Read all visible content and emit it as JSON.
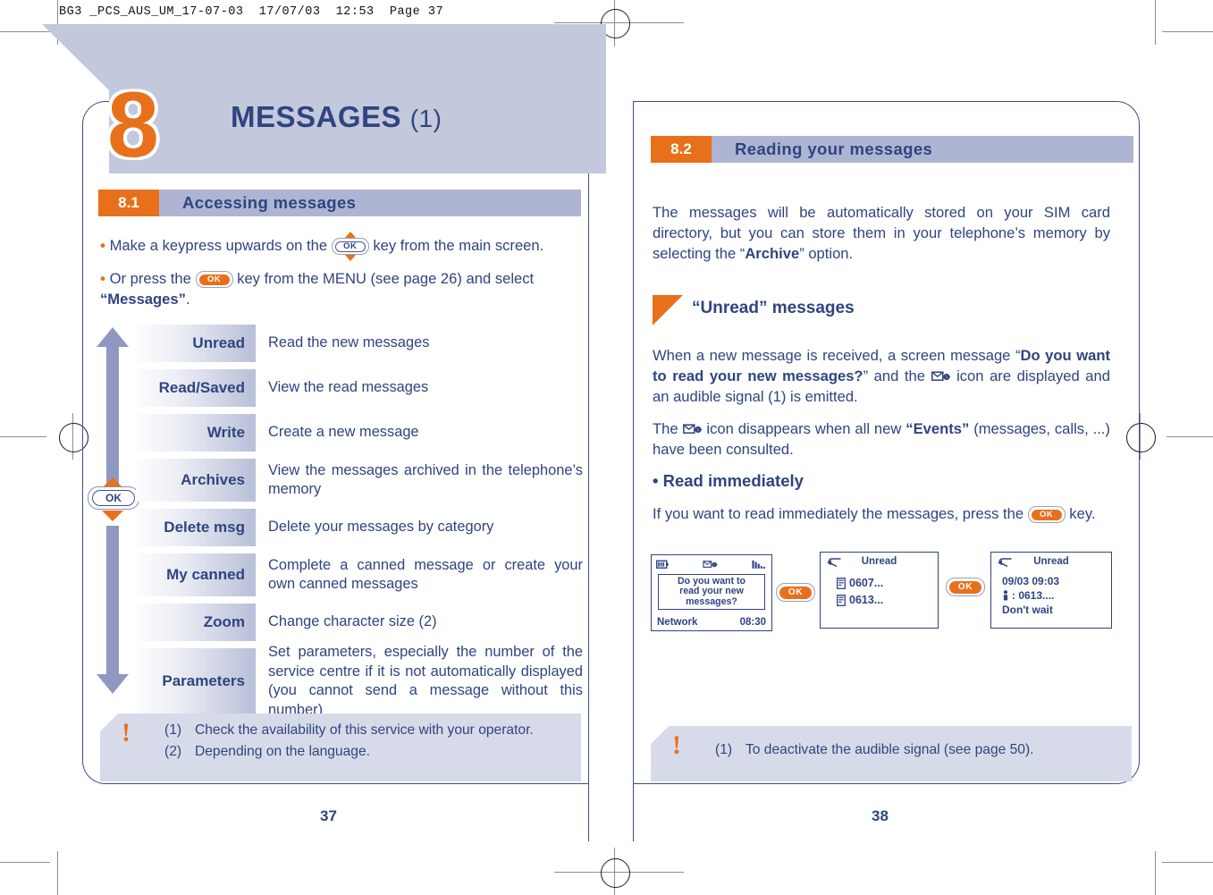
{
  "print_header": "BG3 _PCS_AUS_UM_17-07-03  17/07/03  12:53  Page 37",
  "chapter": {
    "number": "8",
    "title": "MESSAGES",
    "roman": "(1)"
  },
  "left_page": {
    "page_number": "37",
    "section": {
      "number": "8.1",
      "name": "Accessing messages"
    },
    "bullets": [
      {
        "before": "Make a keypress upwards on the",
        "key": "OK",
        "after": "key from the main screen."
      },
      {
        "before": "Or press the",
        "key": "OK",
        "after": "key from the MENU (see page 26) and select",
        "bold_tail": "“Messages”",
        "tail_end": "."
      }
    ],
    "menu_items": [
      {
        "label": "Unread",
        "desc": "Read the new messages"
      },
      {
        "label": "Read/Saved",
        "desc": "View the read messages"
      },
      {
        "label": "Write",
        "desc": "Create a new message"
      },
      {
        "label": "Archives",
        "desc": "View the messages archived in the telephone’s memory"
      },
      {
        "label": "Delete msg",
        "desc": "Delete your messages by category"
      },
      {
        "label": "My canned",
        "desc": "Complete a canned message or create your own canned messages"
      },
      {
        "label": "Zoom",
        "desc": "Change character size (2)"
      },
      {
        "label": "Parameters",
        "desc": "Set parameters, especially the number of the service centre if it is not automatically displayed (you cannot send a message without this number)"
      }
    ],
    "nav_key_label": "OK",
    "footnotes": [
      {
        "num": "(1)",
        "text": "Check the availability of this service with your operator."
      },
      {
        "num": "(2)",
        "text": "Depending on the language."
      }
    ]
  },
  "right_page": {
    "page_number": "38",
    "section": {
      "number": "8.2",
      "name": "Reading your messages"
    },
    "intro": {
      "part1": "The messages will be automatically stored on your SIM card directory, but you can store them in your telephone’s memory by selecting the “",
      "bold": "Archive",
      "part2": "” option."
    },
    "subsection_title": "“Unread” messages",
    "para1": {
      "part1": "When a new message is received, a screen message “",
      "bold1": "Do you want to read your new messages?",
      "part2": "” and the",
      "icon": "envelope-event-icon",
      "part3": "icon are displayed and an audible signal (1) is emitted."
    },
    "para2": {
      "part1": "The",
      "icon": "envelope-event-icon",
      "part2": "icon disappears when all new",
      "bold1": "“Events”",
      "part3": "(messages, calls, ...) have been consulted."
    },
    "read_immediately_heading": "• Read immediately",
    "para3": {
      "part1": "If you want to read immediately the messages, press the",
      "key": "OK",
      "part2": "key."
    },
    "phone_screens": [
      {
        "id": "screen-prompt",
        "status_icons": [
          "battery-icon",
          "envelope-event-icon",
          "signal-icon"
        ],
        "dialog_lines": [
          "Do you want to",
          "read your new",
          "messages?"
        ],
        "footer_left": "Network",
        "footer_right": "08:30"
      },
      {
        "id": "screen-unread-list",
        "title": "Unread",
        "back_icon": "back-arrow-icon",
        "items": [
          "0607...",
          "0613..."
        ]
      },
      {
        "id": "screen-message-detail",
        "title": "Unread",
        "back_icon": "back-arrow-icon",
        "timestamp": "09/03 09:03",
        "sender": ": 0613....",
        "body": "Don't wait"
      }
    ],
    "ok_buttons": [
      "OK",
      "OK"
    ],
    "footnotes": [
      {
        "num": "(1)",
        "text": "To deactivate the audible signal (see page 50)."
      }
    ]
  },
  "colors": {
    "accent_orange": "#e8701a",
    "brand_blue": "#2f4480",
    "bar_blue": "#aeb5d2",
    "banner_grey": "#c3c8dd",
    "footnote_grey": "#d7dbe9"
  }
}
